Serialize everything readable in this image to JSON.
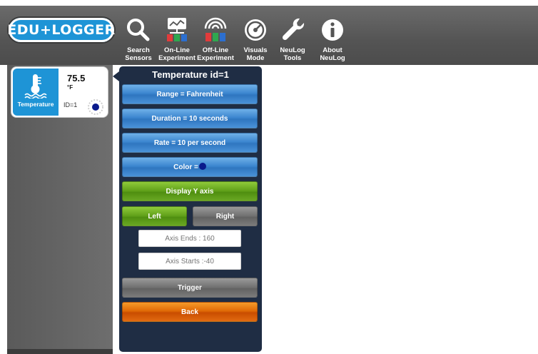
{
  "app": {
    "logo_text": "EDU+LOGGER"
  },
  "toolbar": {
    "items": [
      {
        "label": "Search\nSensors",
        "icon": "search-icon"
      },
      {
        "label": "On-Line\nExperiment",
        "icon": "online-experiment-icon"
      },
      {
        "label": "Off-Line\nExperiment",
        "icon": "offline-experiment-icon"
      },
      {
        "label": "Visuals\nMode",
        "icon": "visuals-mode-icon"
      },
      {
        "label": "NeuLog\nTools",
        "icon": "wrench-icon"
      },
      {
        "label": "About\nNeuLog",
        "icon": "info-icon"
      }
    ]
  },
  "sensor": {
    "name": "Temperature",
    "value": "75.5",
    "unit": "°F",
    "id_label": "ID=1",
    "icon": "thermometer-icon",
    "color": "#0a1a8c"
  },
  "panel": {
    "title": "Temperature id=1",
    "range_label": "Range = Fahrenheit",
    "duration_label": "Duration = 10 seconds",
    "rate_label": "Rate = 10 per second",
    "color_label": "Color =",
    "display_y_label": "Display Y axis",
    "left_label": "Left",
    "right_label": "Right",
    "axis_ends_placeholder": "Axis Ends : 160",
    "axis_starts_placeholder": "Axis Starts :-40",
    "trigger_label": "Trigger",
    "back_label": "Back"
  },
  "colors": {
    "toolbar": "#555555",
    "accent_blue": "#1e94d6",
    "panel_bg": "#1f2d44",
    "green": "#5e9e18",
    "orange": "#e06a06"
  }
}
